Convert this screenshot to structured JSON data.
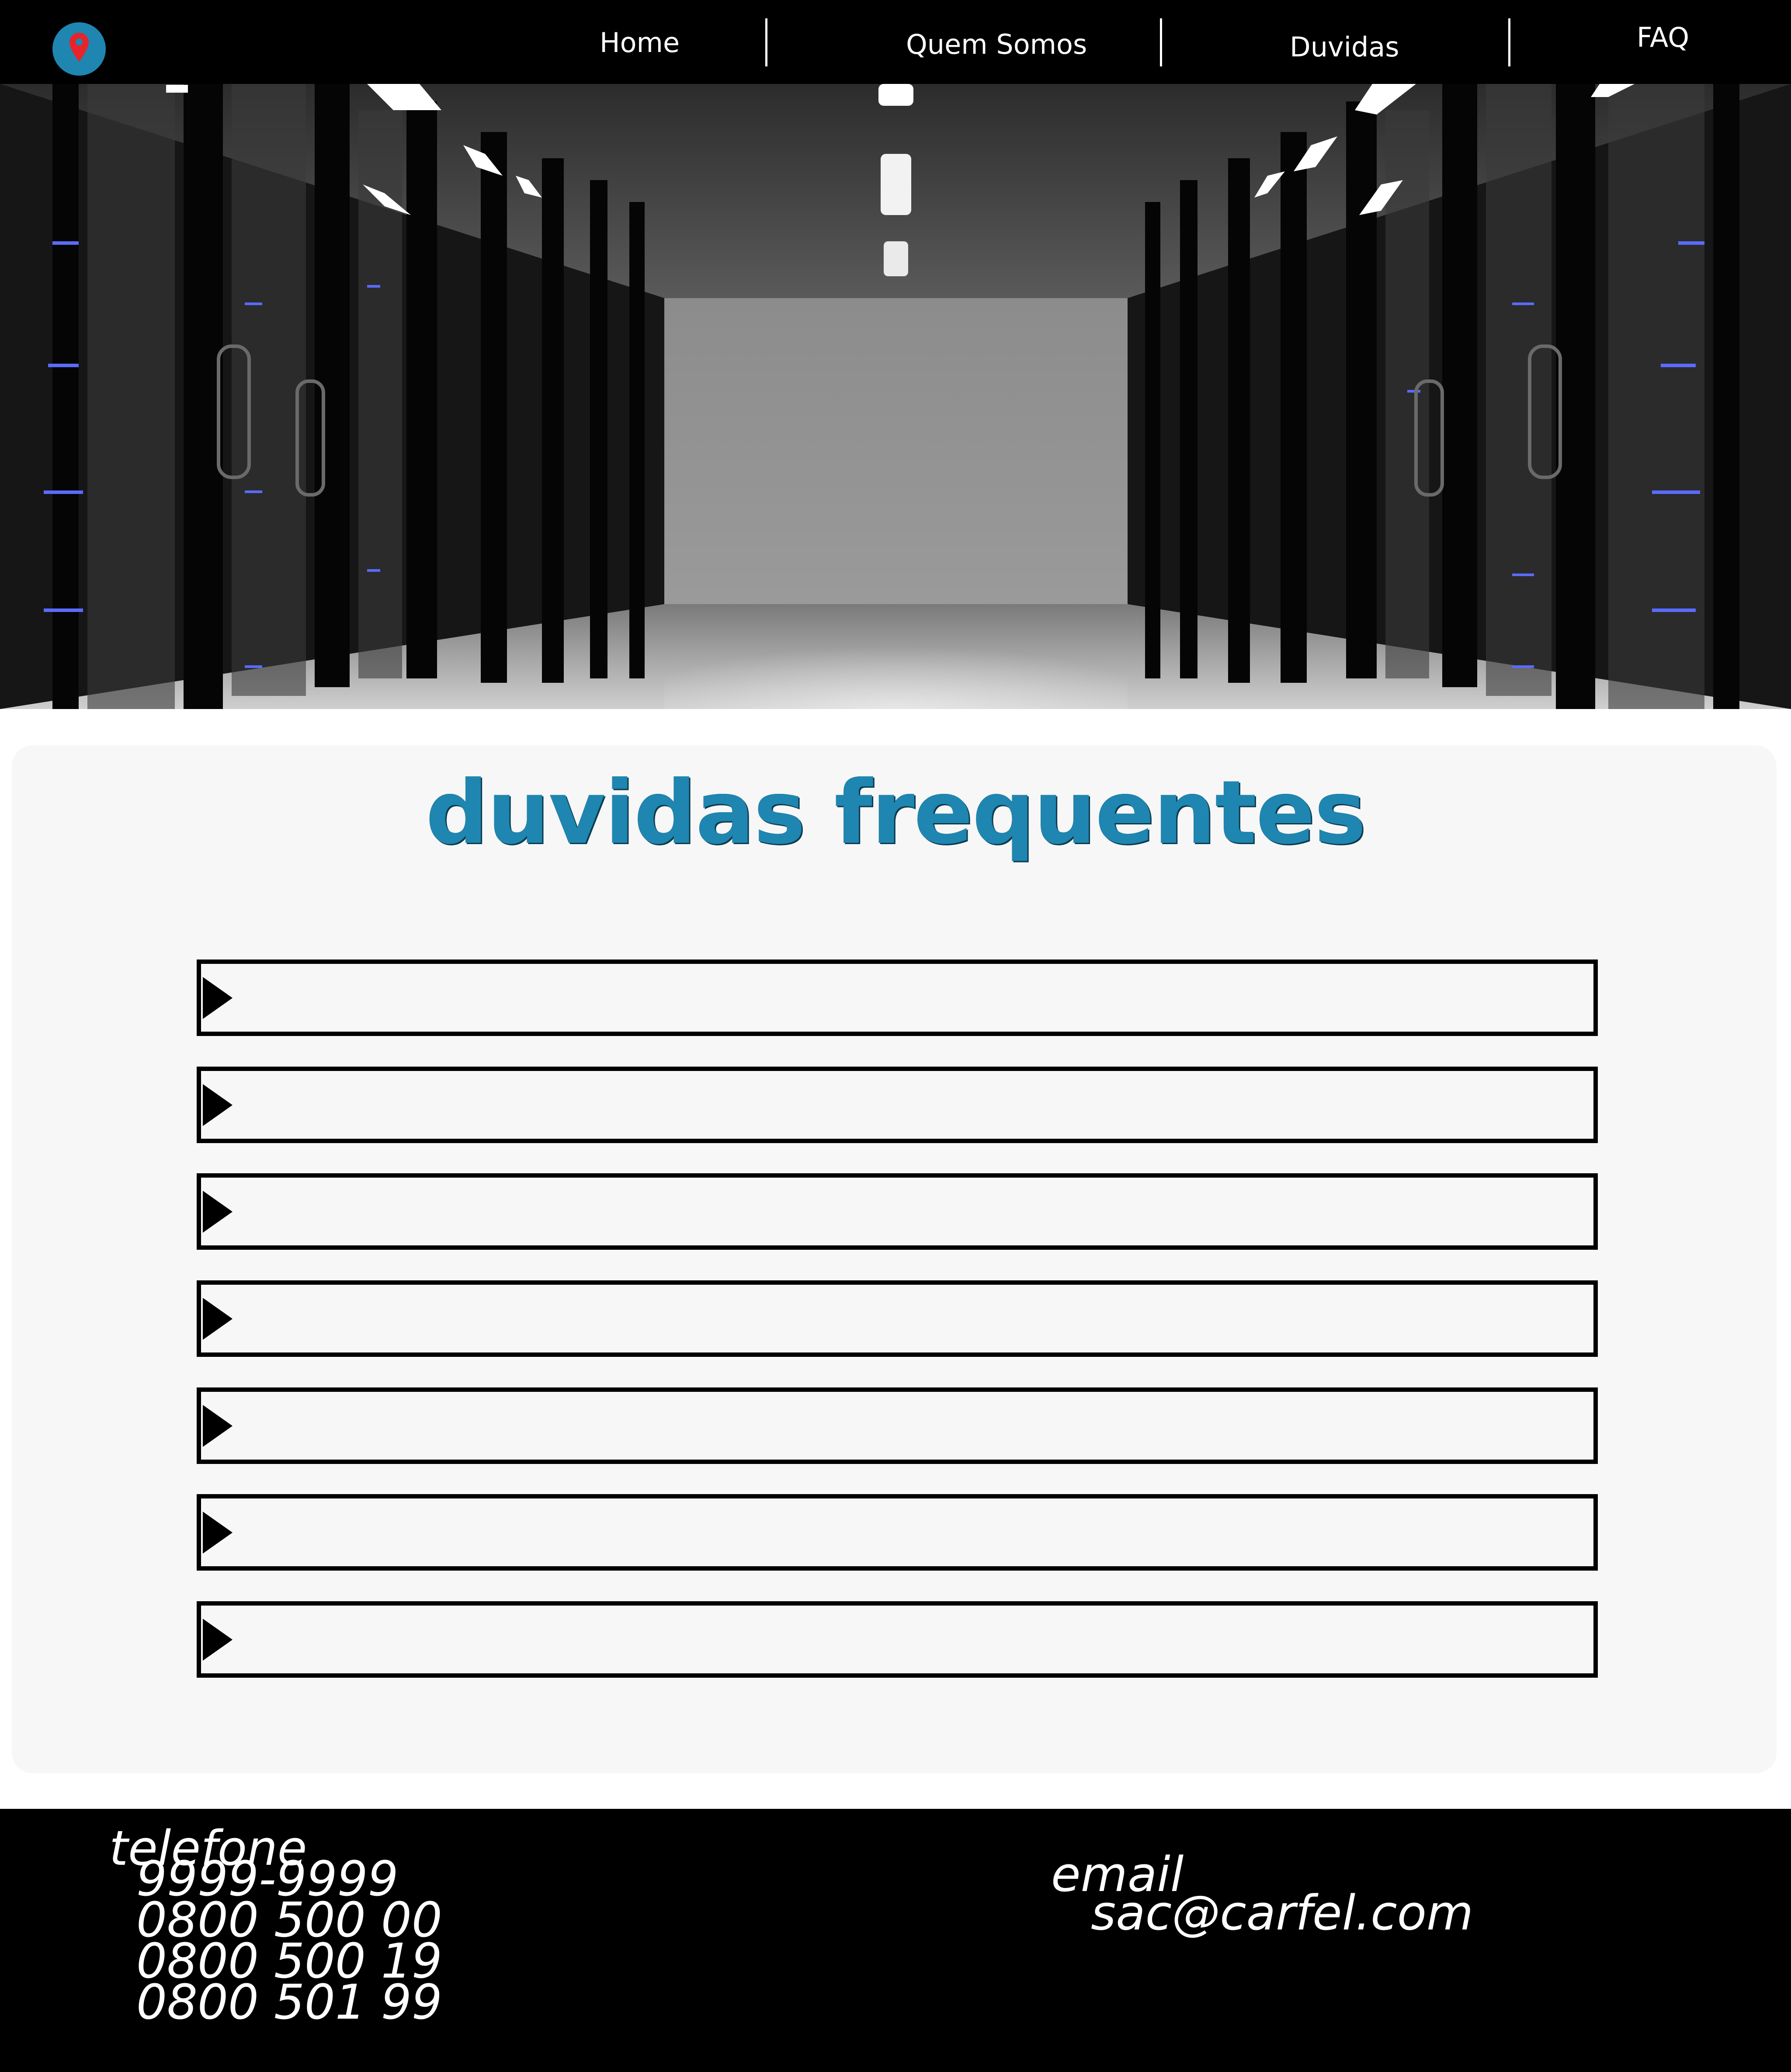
{
  "nav": {
    "links": [
      "Home",
      "Quem Somos",
      "Duvidas",
      "FAQ"
    ]
  },
  "icons": {
    "logo": "location-pin-icon",
    "faq_toggle": "caret-right-icon"
  },
  "colors": {
    "accent": "#1e86b0",
    "pin": "#e8232b",
    "panel": "#f7f7f7",
    "nav_background": "#000000"
  },
  "faq": {
    "title": "duvidas frequentes",
    "items": [
      "",
      "",
      "",
      "",
      "",
      "",
      ""
    ]
  },
  "footer": {
    "phone_label": "telefone",
    "phones": [
      "9999-9999",
      "0800 500 00",
      "0800 500 19",
      "0800 501 99"
    ],
    "email_label": "email",
    "email": "sac@carfel.com"
  }
}
